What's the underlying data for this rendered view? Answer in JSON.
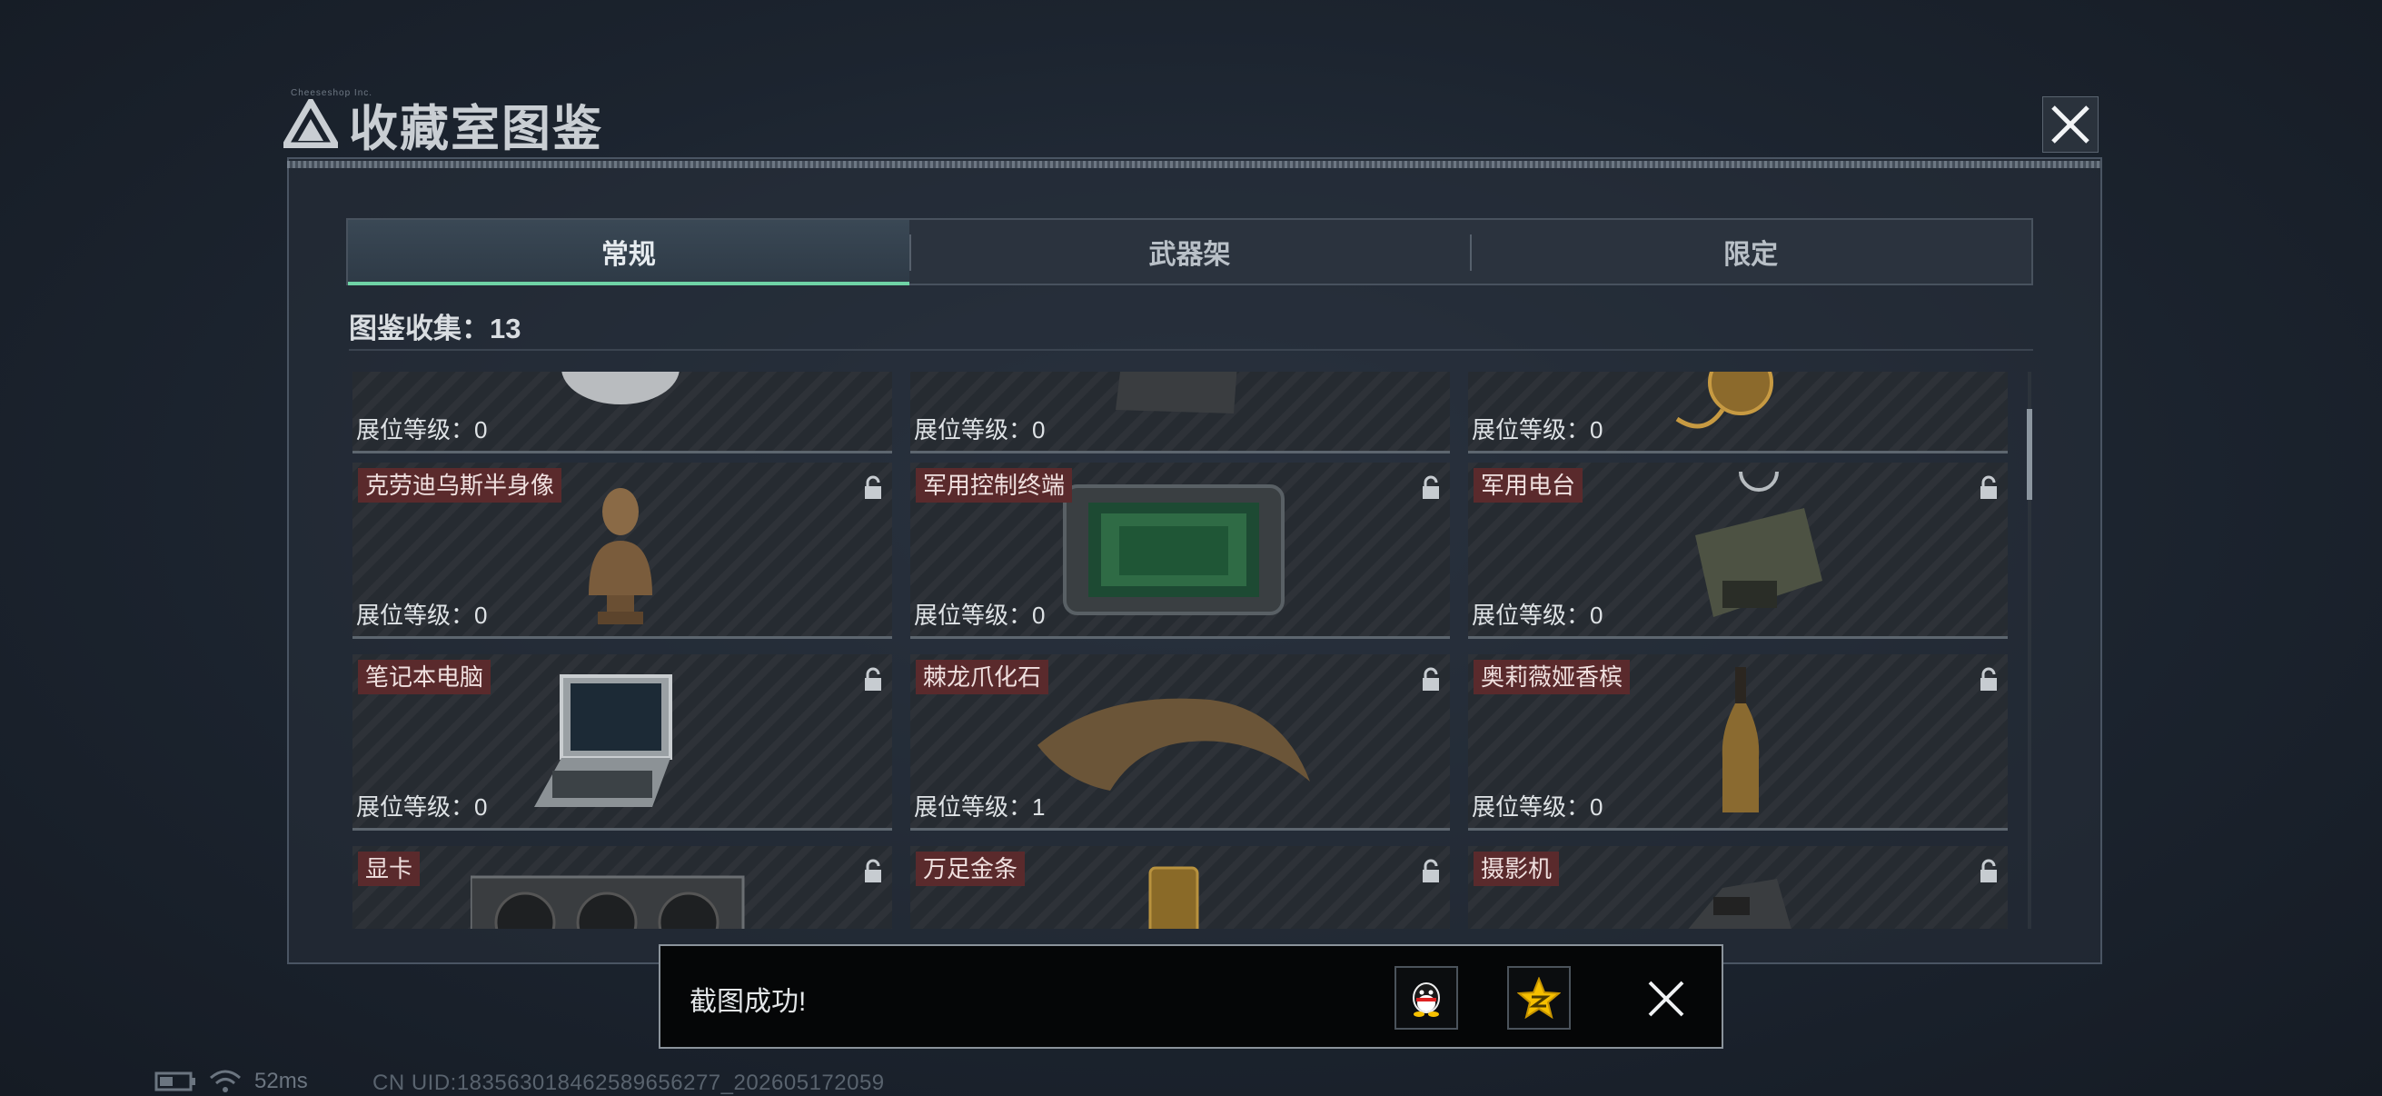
{
  "window": {
    "title": "收藏室图鉴",
    "small_caption": "Cheeseshop Inc.",
    "accent_color": "#6fd3a6"
  },
  "tabs": [
    {
      "label": "常规",
      "active": true
    },
    {
      "label": "武器架",
      "active": false
    },
    {
      "label": "限定",
      "active": false
    }
  ],
  "collection": {
    "label": "图鉴收集：13"
  },
  "cards": [
    {
      "name": "",
      "level": "展位等级：0",
      "art": "plate",
      "locked": false
    },
    {
      "name": "",
      "level": "展位等级：0",
      "art": "slab",
      "locked": false
    },
    {
      "name": "",
      "level": "展位等级：0",
      "art": "pocket-watch",
      "locked": false
    },
    {
      "name": "克劳迪乌斯半身像",
      "level": "展位等级：0",
      "art": "bust",
      "locked": true
    },
    {
      "name": "军用控制终端",
      "level": "展位等级：0",
      "art": "terminal",
      "locked": true
    },
    {
      "name": "军用电台",
      "level": "展位等级：0",
      "art": "radio",
      "locked": true
    },
    {
      "name": "笔记本电脑",
      "level": "展位等级：0",
      "art": "laptop",
      "locked": true
    },
    {
      "name": "棘龙爪化石",
      "level": "展位等级：1",
      "art": "claw-fossil",
      "locked": true
    },
    {
      "name": "奥莉薇娅香槟",
      "level": "展位等级：0",
      "art": "champagne",
      "locked": true
    },
    {
      "name": "显卡",
      "level": "",
      "art": "gpu",
      "locked": true
    },
    {
      "name": "万足金条",
      "level": "",
      "art": "gold-bar",
      "locked": true
    },
    {
      "name": "摄影机",
      "level": "",
      "art": "camera",
      "locked": true
    }
  ],
  "toast": {
    "message": "截图成功!",
    "share_icons": [
      "qq-icon",
      "qzone-star-icon"
    ]
  },
  "status": {
    "ping": "52ms",
    "uid": "CN UID:183563018462589656277_202605172059"
  }
}
